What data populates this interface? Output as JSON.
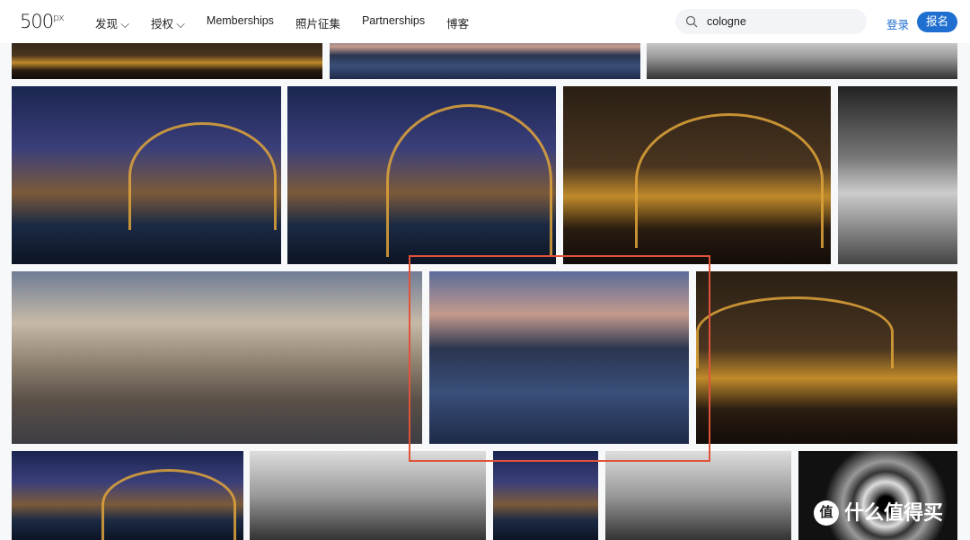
{
  "header": {
    "logo": "500px",
    "nav": [
      {
        "label": "发现 ⌵"
      },
      {
        "label": "授权 ⌵"
      },
      {
        "label": "Memberships"
      },
      {
        "label": "照片征集"
      },
      {
        "label": "Partnerships"
      },
      {
        "label": "博客"
      }
    ],
    "search_value": "cologne",
    "login_label": "登录",
    "signup_label": "报名"
  },
  "watermark": {
    "text": "什么值得买",
    "badge": "值"
  },
  "highlight_color": "#e0533a",
  "accent_color": "#1f6fd0"
}
